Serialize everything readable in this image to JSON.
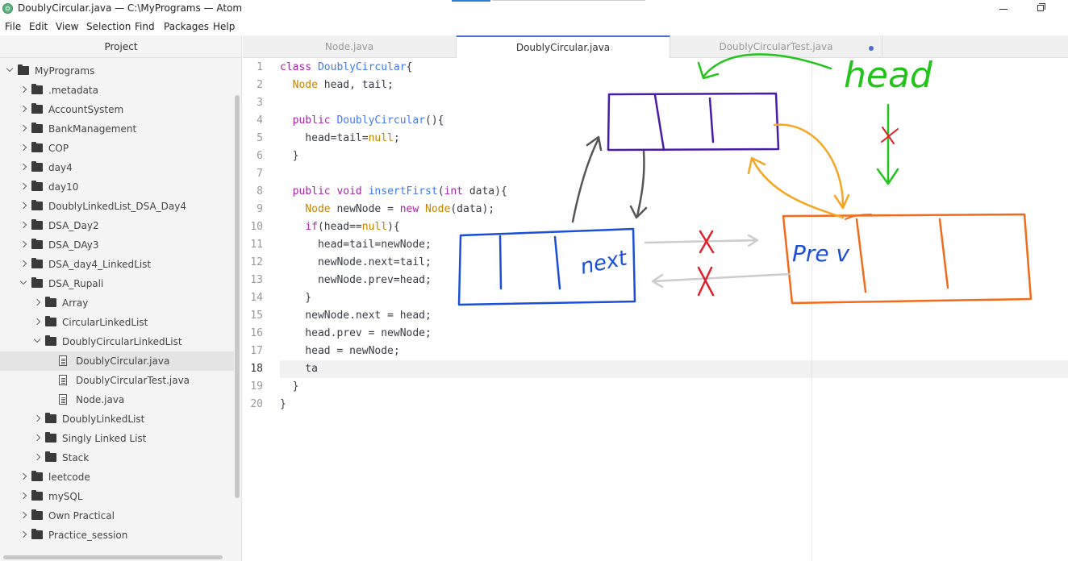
{
  "window": {
    "title": "DoublyCircular.java — C:\\MyPrograms — Atom"
  },
  "menu": [
    "File",
    "Edit",
    "View",
    "Selection",
    "Find",
    "Packages",
    "Help"
  ],
  "sidebar": {
    "header": "Project",
    "tree": [
      {
        "label": "MyPrograms",
        "kind": "folder",
        "depth": 0,
        "expanded": true
      },
      {
        "label": ".metadata",
        "kind": "folder",
        "depth": 1,
        "expanded": false
      },
      {
        "label": "AccountSystem",
        "kind": "folder",
        "depth": 1,
        "expanded": false
      },
      {
        "label": "BankManagement",
        "kind": "folder",
        "depth": 1,
        "expanded": false
      },
      {
        "label": "COP",
        "kind": "folder",
        "depth": 1,
        "expanded": false
      },
      {
        "label": "day4",
        "kind": "folder",
        "depth": 1,
        "expanded": false
      },
      {
        "label": "day10",
        "kind": "folder",
        "depth": 1,
        "expanded": false
      },
      {
        "label": "DoublyLinkedList_DSA_Day4",
        "kind": "folder",
        "depth": 1,
        "expanded": false
      },
      {
        "label": "DSA_Day2",
        "kind": "folder",
        "depth": 1,
        "expanded": false
      },
      {
        "label": "DSA_DAy3",
        "kind": "folder",
        "depth": 1,
        "expanded": false
      },
      {
        "label": "DSA_day4_LinkedList",
        "kind": "folder",
        "depth": 1,
        "expanded": false
      },
      {
        "label": "DSA_Rupali",
        "kind": "folder",
        "depth": 1,
        "expanded": true
      },
      {
        "label": "Array",
        "kind": "folder",
        "depth": 2,
        "expanded": false
      },
      {
        "label": "CircularLinkedList",
        "kind": "folder",
        "depth": 2,
        "expanded": false
      },
      {
        "label": "DoublyCircularLinkedList",
        "kind": "folder",
        "depth": 2,
        "expanded": true
      },
      {
        "label": "DoublyCircular.java",
        "kind": "file",
        "depth": 3,
        "selected": true
      },
      {
        "label": "DoublyCircularTest.java",
        "kind": "file",
        "depth": 3
      },
      {
        "label": "Node.java",
        "kind": "file",
        "depth": 3
      },
      {
        "label": "DoublyLinkedList",
        "kind": "folder",
        "depth": 2,
        "expanded": false
      },
      {
        "label": "Singly Linked List",
        "kind": "folder",
        "depth": 2,
        "expanded": false
      },
      {
        "label": "Stack",
        "kind": "folder",
        "depth": 2,
        "expanded": false
      },
      {
        "label": "leetcode",
        "kind": "folder",
        "depth": 1,
        "expanded": false
      },
      {
        "label": "mySQL",
        "kind": "folder",
        "depth": 1,
        "expanded": false
      },
      {
        "label": "Own Practical",
        "kind": "folder",
        "depth": 1,
        "expanded": false
      },
      {
        "label": "Practice_session",
        "kind": "folder",
        "depth": 1,
        "expanded": false
      }
    ]
  },
  "tabs": [
    {
      "label": "Node.java",
      "active": false
    },
    {
      "label": "DoublyCircular.java",
      "active": true,
      "modified": true
    },
    {
      "label": "DoublyCircularTest.java",
      "active": false
    }
  ],
  "editor": {
    "cursor_line": 18,
    "lines": [
      "class DoublyCircular{",
      "  Node head, tail;",
      "",
      "  public DoublyCircular(){",
      "    head=tail=null;",
      "  }",
      "",
      "  public void insertFirst(int data){",
      "    Node newNode = new Node(data);",
      "    if(head==null){",
      "      head=tail=newNode;",
      "      newNode.next=tail;",
      "      newNode.prev=head;",
      "    }",
      "    newNode.next = head;",
      "    head.prev = newNode;",
      "    head = newNode;",
      "    ta",
      "  }",
      "}"
    ]
  },
  "annotations": {
    "labels": {
      "head": "head",
      "next": "next",
      "prev": "Pre v"
    },
    "colors": {
      "green": "#22c41c",
      "purple": "#4a1aa8",
      "blue": "#1a4fd6",
      "orange": "#f26a1b",
      "yellow": "#f5a623",
      "red": "#e0202a",
      "gray": "#555555",
      "light_gray": "#cccccc"
    }
  },
  "colors": {
    "accent": "#4a6bd6",
    "sidebar_bg": "#f4f4f4",
    "keyword": "#a626a4",
    "type": "#c18401",
    "function": "#4078f2"
  }
}
